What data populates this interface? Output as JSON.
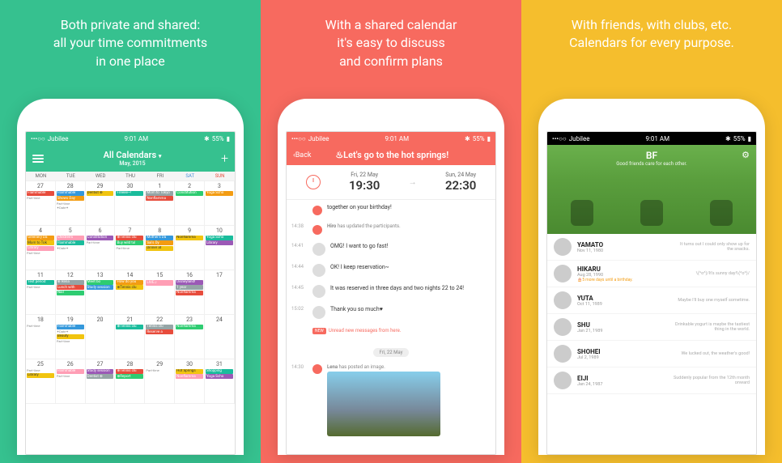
{
  "panels": {
    "green": {
      "tagline": "Both private and shared:\nall your time commitments\nin one place"
    },
    "red": {
      "tagline": "With a shared calendar\nit's easy to discuss\nand confirm plans"
    },
    "yellow": {
      "tagline": "With friends, with clubs, etc.\nCalendars for every purpose."
    }
  },
  "status": {
    "carrier": "Jubilee",
    "time": "9:01 AM",
    "battery": "55%",
    "signal": "•••○○"
  },
  "cal": {
    "title": "All Calendars",
    "subtitle": "May, 2015",
    "days": [
      "MON",
      "TUE",
      "WED",
      "THU",
      "FRI",
      "SAT",
      "SUN"
    ],
    "weeks": [
      {
        "nums": [
          "27",
          "28",
          "29",
          "30",
          "1",
          "2",
          "3"
        ],
        "events": [
          [
            "Flammable",
            "Part-time"
          ],
          [
            "Flammable",
            "Shows Day",
            "Part-time",
            "✦Date✦"
          ],
          [
            "Dentist ⊕"
          ],
          [
            "Freeee~!"
          ],
          [
            "Mom to Tokyo",
            "Nonflamma"
          ],
          [
            "Constitution"
          ],
          [
            "Yoga Scho"
          ]
        ]
      },
      {
        "nums": [
          "4",
          "5",
          "6",
          "7",
          "8",
          "9",
          "10"
        ],
        "events": [
          [
            "Greenery Da",
            "Mom to Tok",
            "Library",
            "Part-time"
          ],
          [
            "Children's",
            "Flammable",
            "✦Date✦"
          ],
          [
            "Constitution",
            "Part-time"
          ],
          [
            "⊕Tennis clu",
            "Buy wild tul",
            "Part-time"
          ],
          [
            "Mother's Da",
            "Sai's Dy",
            "Dinner at"
          ],
          [
            "Nonflamma"
          ],
          [
            "Yoga Scho",
            "Library"
          ]
        ]
      },
      {
        "nums": [
          "11",
          "12",
          "13",
          "14",
          "15",
          "16",
          "17"
        ],
        "events": [
          [
            "Test period",
            "Part-time"
          ],
          [
            "⊕ Rena",
            "Lunch with",
            "Nail"
          ],
          [
            "Meet bo",
            "Study session"
          ],
          [
            "How do you",
            "⊕Tennis clu"
          ],
          [
            "LIVE♫"
          ],
          [
            "Disneyland!",
            "1 year",
            "Nonflamma"
          ],
          []
        ]
      },
      {
        "nums": [
          "18",
          "19",
          "20",
          "21",
          "22",
          "23",
          "24"
        ],
        "events": [
          [
            "Part-time"
          ],
          [
            "Flammable",
            "✦Date✦",
            "Beauty",
            "Part-time"
          ],
          [],
          [
            "⊕Tennis clu"
          ],
          [
            "Tennis clu",
            "Reserve a"
          ],
          [
            "Nonflamma"
          ],
          []
        ]
      },
      {
        "nums": [
          "25",
          "26",
          "27",
          "28",
          "29",
          "30",
          "31"
        ],
        "events": [
          [
            "Part-time",
            "Library"
          ],
          [
            "Flammable",
            "Part-time"
          ],
          [
            "Study session",
            "Dentist ⊕"
          ],
          [
            "⊕Tennis clu",
            "⊕Report"
          ],
          [
            "Part-time"
          ],
          [
            "Hot Springs",
            "Nonflamma"
          ],
          [
            "Shopping",
            "Yoga Scho"
          ]
        ]
      }
    ]
  },
  "chat": {
    "back": "Back",
    "title": "♨Let's go to the hot springs!",
    "from": {
      "date": "Fri, 22 May",
      "time": "19:30"
    },
    "to": {
      "date": "Sun, 24 May",
      "time": "22:30"
    },
    "items": [
      {
        "time": "",
        "sys": true,
        "text": "together on your birthday!"
      },
      {
        "time": "14:38",
        "sys": true,
        "who": "Hiro",
        "text": "has updated the participants."
      },
      {
        "time": "14:41",
        "text": "OMG! I want to go fast!"
      },
      {
        "time": "14:44",
        "text": "OK! I keep reservation~"
      },
      {
        "time": "14:45",
        "text": "It was reserved in three days and two nights 22 to 24!"
      },
      {
        "time": "15:02",
        "text": "Thank you so much♥"
      }
    ],
    "unread": "Unread new messages from here.",
    "divider": "Fri, 22 May",
    "imgpost": {
      "time": "14:30",
      "who": "Lena",
      "text": "has posted an image."
    }
  },
  "group": {
    "title": "BF",
    "subtitle": "Good friends care for each other.",
    "friends": [
      {
        "name": "YAMATO",
        "date": "Nov 11, 1980",
        "status": "It turns out I could only show up for the snacks."
      },
      {
        "name": "HIKARU",
        "date": "Aug 28, 1990",
        "birthday": "🎂5 more days until a birthday.",
        "status": "\\(^o^)/It's sunny day!\\(^o^)/"
      },
      {
        "name": "YUTA",
        "date": "Oct 11, 1989",
        "status": "Maybe I'll buy one myself sometime."
      },
      {
        "name": "SHU",
        "date": "Jan 21, 1989",
        "status": "Drinkable yogurt is maybe the tastiest thing in the world."
      },
      {
        "name": "SHOHEI",
        "date": "Jul 2, 1989",
        "status": "We lucked out, the weather's good!"
      },
      {
        "name": "EIJI",
        "date": "Jan 24, 1987",
        "status": "Suddenly popular from the 12th month onward"
      }
    ]
  }
}
